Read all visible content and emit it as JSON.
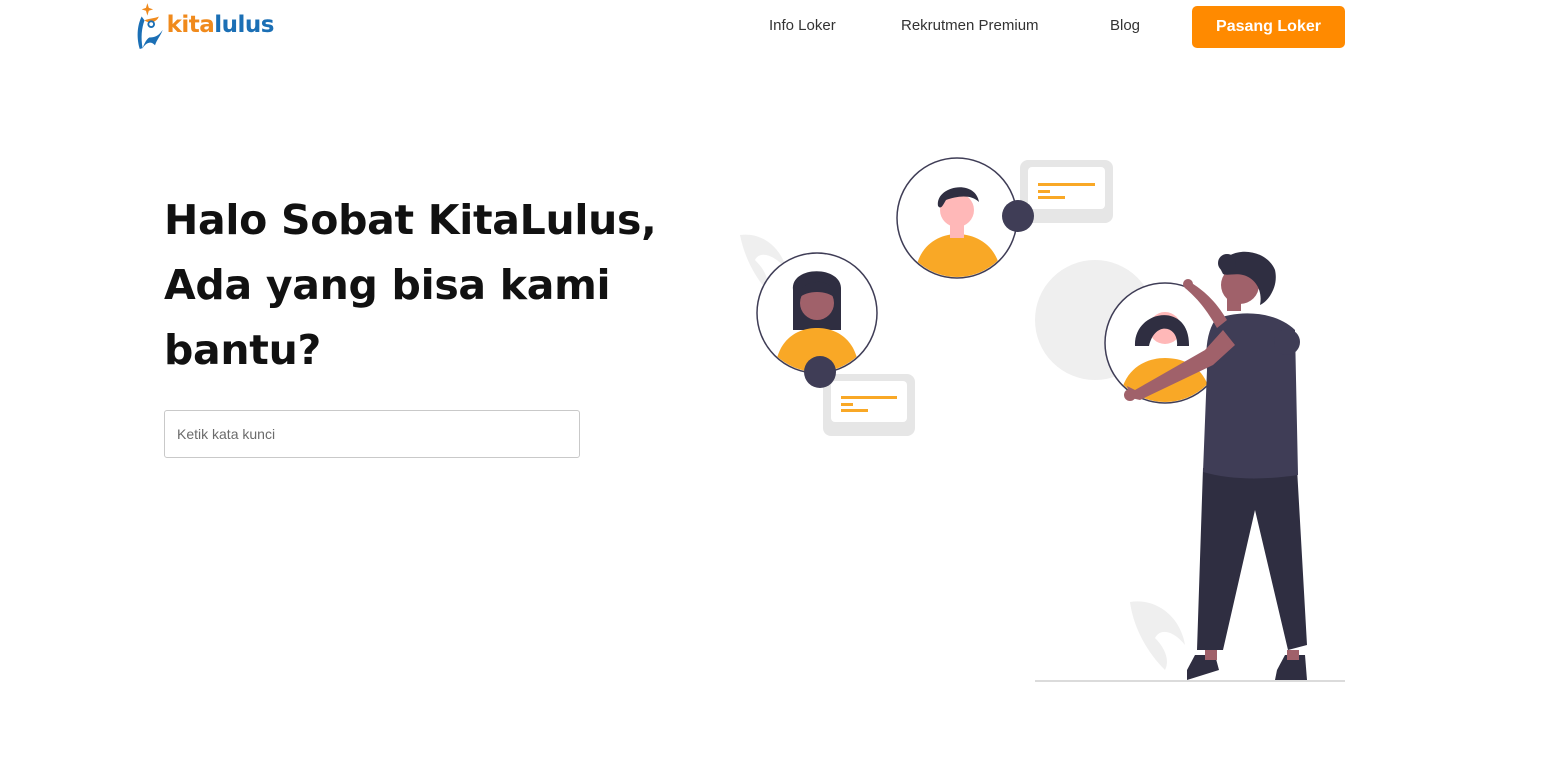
{
  "brand": {
    "name_part1": "kita",
    "name_part2": "lulus",
    "colors": {
      "orange": "#F08A1C",
      "blue": "#1B6FB5"
    }
  },
  "nav": {
    "links": [
      {
        "label": "Info Loker"
      },
      {
        "label": "Rekrutmen Premium"
      },
      {
        "label": "Blog"
      }
    ],
    "cta_label": "Pasang Loker",
    "cta_color": "#FF8A00"
  },
  "hero": {
    "title_line1": "Halo Sobat KitaLulus,",
    "title_line2": "Ada yang bisa kami",
    "title_line3": "bantu?"
  },
  "search": {
    "value": "",
    "placeholder": "Ketik kata kunci"
  },
  "illustration": {
    "colors": {
      "accent": "#F9A826",
      "dark": "#3F3D56",
      "light_gray": "#EFEFEF",
      "skin_light": "#FFB8B8",
      "skin_dark": "#A0616A"
    }
  }
}
